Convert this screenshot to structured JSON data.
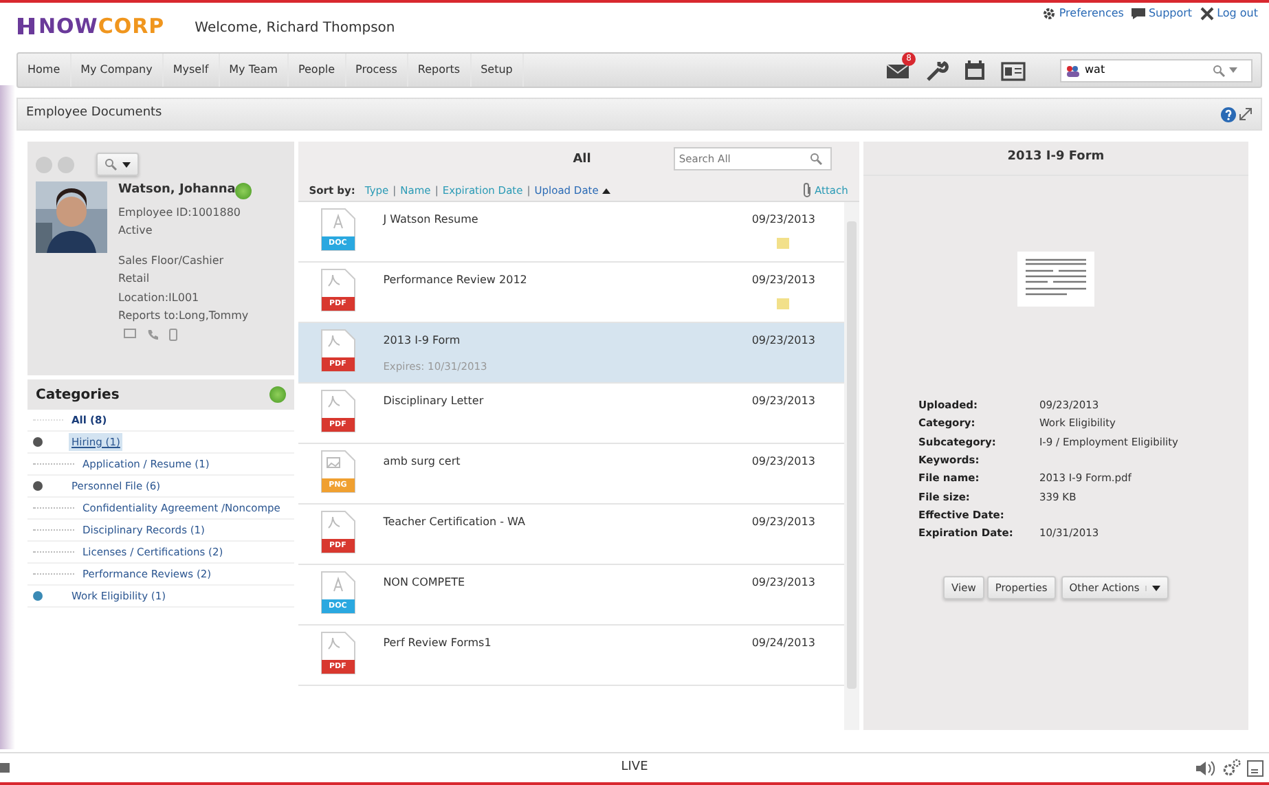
{
  "header": {
    "logo_first": "NOW",
    "logo_second": "CORP",
    "welcome": "Welcome, Richard Thompson",
    "links": [
      {
        "label": "Preferences",
        "kind": "gear"
      },
      {
        "label": "Support",
        "kind": "chat"
      },
      {
        "label": "Log out",
        "kind": "close"
      }
    ]
  },
  "nav": {
    "items": [
      "Home",
      "My Company",
      "Myself",
      "My Team",
      "People",
      "Process",
      "Reports",
      "Setup"
    ],
    "toolbar": [
      {
        "kind": "mail",
        "badge": "8"
      },
      {
        "kind": "tools"
      },
      {
        "kind": "calendar"
      },
      {
        "kind": "card"
      }
    ],
    "search": {
      "value": "wat"
    }
  },
  "panel": {
    "title": "Employee Documents"
  },
  "employee": {
    "name": "Watson, Johanna",
    "id": "Employee ID:1001880",
    "status": "Active",
    "details": [
      "Sales Floor/Cashier",
      "Retail",
      "Location:IL001",
      "Reports to:Long,Tommy"
    ]
  },
  "categories": {
    "title": "Categories",
    "items": [
      {
        "label": "All (8)",
        "kind": "summary",
        "selected": false
      },
      {
        "label": "Hiring (1)",
        "kind": "category",
        "selected": true,
        "expanded": true,
        "children": [
          {
            "label": "Application / Resume (1)",
            "selected": false
          }
        ]
      },
      {
        "label": "Personnel File (6)",
        "kind": "category",
        "selected": false,
        "expanded": true,
        "children": [
          {
            "label": "Confidentiality Agreement /Noncompe",
            "selected": false
          },
          {
            "label": "Disciplinary Records (1)",
            "selected": false
          },
          {
            "label": "Licenses / Certifications (2)",
            "selected": false
          },
          {
            "label": "Performance Reviews (2)",
            "selected": false
          }
        ]
      },
      {
        "label": "Work Eligibility (1)",
        "kind": "category",
        "selected": false,
        "expanded": false
      }
    ]
  },
  "documents": {
    "title": "All",
    "search_placeholder": "Search All",
    "sort_label": "Sort by:",
    "sort_separator": "|",
    "sort_options": [
      {
        "label": "Type",
        "selected": false
      },
      {
        "label": "Name",
        "selected": false
      },
      {
        "label": "Expiration Date",
        "selected": false
      },
      {
        "label": "Upload Date",
        "selected": true
      }
    ],
    "attach": "Attach",
    "items": [
      {
        "name": "J Watson Resume",
        "date": "09/23/2013",
        "kind": "doc",
        "type_label": "DOC",
        "note": true,
        "selected": false
      },
      {
        "name": "Performance Review 2012",
        "date": "09/23/2013",
        "kind": "pdf",
        "type_label": "PDF",
        "note": true,
        "selected": false
      },
      {
        "name": "2013 I-9 Form",
        "date": "09/23/2013",
        "kind": "pdf",
        "type_label": "PDF",
        "note": false,
        "selected": true,
        "expires": "Expires: 10/31/2013"
      },
      {
        "name": "Disciplinary Letter",
        "date": "09/23/2013",
        "kind": "pdf",
        "type_label": "PDF",
        "note": false,
        "selected": false
      },
      {
        "name": "amb surg cert",
        "date": "09/23/2013",
        "kind": "png",
        "type_label": "PNG",
        "note": false,
        "selected": false
      },
      {
        "name": "Teacher Certification - WA",
        "date": "09/23/2013",
        "kind": "pdf",
        "type_label": "PDF",
        "note": false,
        "selected": false
      },
      {
        "name": "NON COMPETE",
        "date": "09/23/2013",
        "kind": "doc",
        "type_label": "DOC",
        "note": false,
        "selected": false
      },
      {
        "name": "Perf Review Forms1",
        "date": "09/24/2013",
        "kind": "pdf",
        "type_label": "PDF",
        "note": false,
        "selected": false
      }
    ]
  },
  "details": {
    "title": "2013 I-9 Form",
    "fields": [
      {
        "label": "Uploaded:",
        "value": "09/23/2013"
      },
      {
        "label": "Category:",
        "value": "Work Eligibility"
      },
      {
        "label": "Subcategory:",
        "value": "I-9 / Employment Eligibility"
      },
      {
        "label": "Keywords:"
      },
      {
        "label": "File name:",
        "value": "2013 I-9 Form.pdf"
      },
      {
        "label": "File size:",
        "value": "339 KB"
      },
      {
        "label": "Effective Date:"
      },
      {
        "label": "Expiration Date:",
        "value": "10/31/2013"
      }
    ],
    "buttons": [
      {
        "label": "View",
        "dropdown": false
      },
      {
        "label": "Properties",
        "dropdown": false
      },
      {
        "label": "Other Actions",
        "dropdown": true
      }
    ]
  },
  "player": {
    "status": "LIVE"
  }
}
